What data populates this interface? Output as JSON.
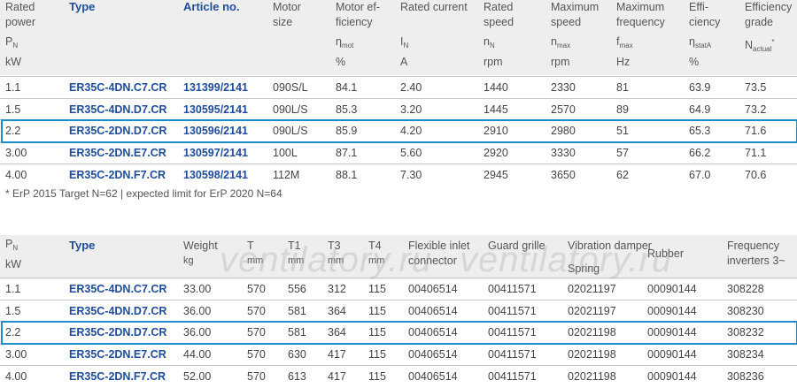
{
  "table1": {
    "headers": [
      {
        "lines": [
          "Rated",
          "power"
        ],
        "sym": "P",
        "sub": "N",
        "unit": "kW"
      },
      {
        "lines": [
          "Type"
        ],
        "bold": true
      },
      {
        "lines": [
          "Article no."
        ],
        "bold": true
      },
      {
        "lines": [
          "Motor",
          "size"
        ]
      },
      {
        "lines": [
          "Motor ef-",
          "ficiency"
        ],
        "sym": "η",
        "sub": "mot",
        "unit": "%"
      },
      {
        "lines": [
          "Rated current"
        ],
        "sym": "I",
        "sub": "N",
        "unit": "A"
      },
      {
        "lines": [
          "Rated",
          "speed"
        ],
        "sym": "n",
        "sub": "N",
        "unit": "rpm"
      },
      {
        "lines": [
          "Maximum",
          "speed"
        ],
        "sym": "n",
        "sub": "max",
        "unit": "rpm"
      },
      {
        "lines": [
          "Maximum",
          "frequency"
        ],
        "sym": "f",
        "sub": "max",
        "unit": "Hz"
      },
      {
        "lines": [
          "Effi-",
          "ciency"
        ],
        "sym": "η",
        "sub": "statA",
        "unit": "%"
      },
      {
        "lines": [
          "Efficiency",
          "grade"
        ],
        "sym": "N",
        "sub": "actual",
        "sup": "*"
      }
    ],
    "rows": [
      [
        "1.1",
        "ER35C-4DN.C7.CR",
        "131399/2141",
        "090S/L",
        "84.1",
        "2.40",
        "1440",
        "2330",
        "81",
        "63.9",
        "73.5"
      ],
      [
        "1.5",
        "ER35C-4DN.D7.CR",
        "130595/2141",
        "090L/S",
        "85.3",
        "3.20",
        "1445",
        "2570",
        "89",
        "64.9",
        "73.2"
      ],
      [
        "2.2",
        "ER35C-2DN.D7.CR",
        "130596/2141",
        "090L/S",
        "85.9",
        "4.20",
        "2910",
        "2980",
        "51",
        "65.3",
        "71.6"
      ],
      [
        "3.00",
        "ER35C-2DN.E7.CR",
        "130597/2141",
        "100L",
        "87.1",
        "5.60",
        "2920",
        "3330",
        "57",
        "66.2",
        "71.1"
      ],
      [
        "4.00",
        "ER35C-2DN.F7.CR",
        "130598/2141",
        "112M",
        "88.1",
        "7.30",
        "2945",
        "3650",
        "62",
        "67.0",
        "70.6"
      ]
    ]
  },
  "footnote": "* ErP 2015 Target N=62 | expected limit for ErP 2020 N=64",
  "table2": {
    "headers": [
      {
        "l1": "P",
        "sub": "N",
        "l2": "kW"
      },
      {
        "l1": "Type",
        "bold": true
      },
      {
        "l1": "Weight",
        "l2": "kg"
      },
      {
        "l1": "T",
        "l2": "mm"
      },
      {
        "l1": "T1",
        "l2": "mm"
      },
      {
        "l1": "T3",
        "l2": "mm"
      },
      {
        "l1": "T4",
        "l2": "mm"
      },
      {
        "l1": "Flexible inlet",
        "l2": "connector"
      },
      {
        "l1": "Guard grille"
      },
      {
        "l1": "Vibration damper",
        "l2": "Spring"
      },
      {
        "l1": "",
        "l2": "Rubber"
      },
      {
        "l1": "Frequency",
        "l2": "inverters 3~"
      }
    ],
    "rows": [
      [
        "1.1",
        "ER35C-4DN.C7.CR",
        "33.00",
        "570",
        "556",
        "312",
        "115",
        "00406514",
        "00411571",
        "02021197",
        "00090144",
        "308228"
      ],
      [
        "1.5",
        "ER35C-4DN.D7.CR",
        "36.00",
        "570",
        "581",
        "364",
        "115",
        "00406514",
        "00411571",
        "02021197",
        "00090144",
        "308230"
      ],
      [
        "2.2",
        "ER35C-2DN.D7.CR",
        "36.00",
        "570",
        "581",
        "364",
        "115",
        "00406514",
        "00411571",
        "02021198",
        "00090144",
        "308232"
      ],
      [
        "3.00",
        "ER35C-2DN.E7.CR",
        "44.00",
        "570",
        "630",
        "417",
        "115",
        "00406514",
        "00411571",
        "02021198",
        "00090144",
        "308234"
      ],
      [
        "4.00",
        "ER35C-2DN.F7.CR",
        "52.00",
        "570",
        "613",
        "417",
        "115",
        "00406514",
        "00411571",
        "02021198",
        "00090144",
        "308236"
      ]
    ]
  },
  "watermark": "ventilatory.ru",
  "colors": {
    "link": "#1f4d9c",
    "highlight": "#1e8ccc",
    "header_bg": "#eeeeee"
  }
}
